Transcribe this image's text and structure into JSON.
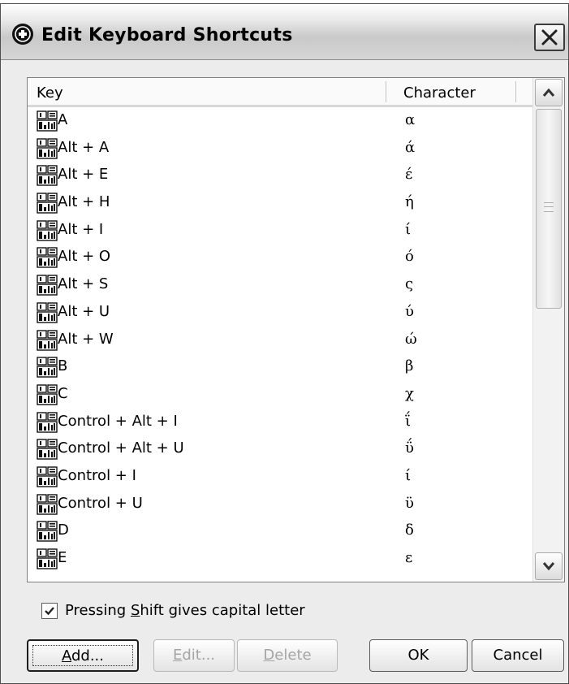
{
  "window": {
    "title": "Edit Keyboard Shortcuts"
  },
  "list": {
    "columns": {
      "key": "Key",
      "character": "Character"
    },
    "rows": [
      {
        "key": "A",
        "character": "α"
      },
      {
        "key": "Alt + A",
        "character": "ά"
      },
      {
        "key": "Alt + E",
        "character": "έ"
      },
      {
        "key": "Alt + H",
        "character": "ή"
      },
      {
        "key": "Alt + I",
        "character": "ί"
      },
      {
        "key": "Alt + O",
        "character": "ό"
      },
      {
        "key": "Alt + S",
        "character": "ς"
      },
      {
        "key": "Alt + U",
        "character": "ύ"
      },
      {
        "key": "Alt + W",
        "character": "ώ"
      },
      {
        "key": "B",
        "character": "β"
      },
      {
        "key": "C",
        "character": "χ"
      },
      {
        "key": "Control + Alt + I",
        "character": "ΐ"
      },
      {
        "key": "Control + Alt + U",
        "character": "ΰ"
      },
      {
        "key": "Control + I",
        "character": "ί"
      },
      {
        "key": "Control + U",
        "character": "ϋ"
      },
      {
        "key": "D",
        "character": "δ"
      },
      {
        "key": "E",
        "character": "ε"
      }
    ]
  },
  "checkbox": {
    "label_pre": "Pressing ",
    "label_accel": "S",
    "label_post": "hift gives capital letter",
    "checked": true
  },
  "buttons": {
    "add": {
      "accel": "A",
      "rest": "dd..."
    },
    "edit": {
      "accel": "E",
      "rest": "dit..."
    },
    "delete": {
      "accel": "D",
      "rest": "elete"
    },
    "ok": "OK",
    "cancel": "Cancel"
  },
  "icons": {
    "app": "menu-circle-icon",
    "close": "close-icon",
    "row": "keyboard-key-icon",
    "scroll_up": "chevron-up-icon",
    "scroll_down": "chevron-down-icon",
    "check": "checkmark-icon"
  }
}
